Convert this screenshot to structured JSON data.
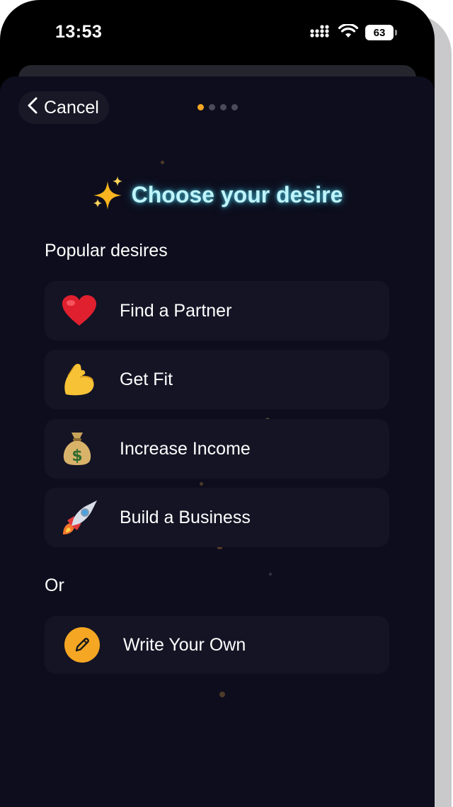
{
  "status_bar": {
    "time": "13:53",
    "battery": "63"
  },
  "header": {
    "cancel_label": "Cancel",
    "pager": {
      "total": 4,
      "active": 1
    }
  },
  "title": "Choose your desire",
  "popular_label": "Popular desires",
  "options": [
    {
      "label": "Find a Partner",
      "icon": "heart-icon"
    },
    {
      "label": "Get Fit",
      "icon": "flexed-biceps-icon"
    },
    {
      "label": "Increase Income",
      "icon": "money-bag-icon"
    },
    {
      "label": "Build a Business",
      "icon": "rocket-icon"
    }
  ],
  "or_label": "Or",
  "write_own_label": "Write Your Own",
  "colors": {
    "background": "#0d0d1d",
    "card": "#141425",
    "accent": "#f5a623",
    "title_glow": "#bff4fb"
  }
}
